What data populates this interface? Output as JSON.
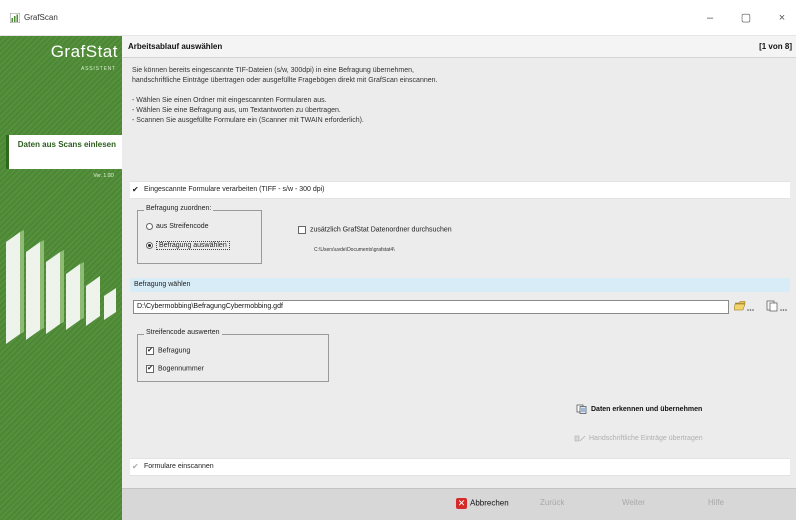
{
  "window": {
    "title": "GrafScan",
    "icon": "grafscan-app-icon",
    "controls": {
      "minimize": "–",
      "maximize": "▢",
      "close": "×"
    }
  },
  "sidebar": {
    "brand": "GrafStat",
    "subtitle": "ASSISTENT",
    "active_item": "Daten aus Scans einlesen",
    "version": "Ver. 1.0D",
    "accent": "#4f8c36"
  },
  "header": {
    "title": "Arbeitsablauf auswählen",
    "page": "[1 von 8]"
  },
  "description": {
    "line1": "Sie können bereits eingescannte TIF-Dateien (s/w, 300dpi) in eine Befragung übernehmen,",
    "line2": "handschriftliche Einträge übertragen oder ausgefüllte Fragebögen direkt mit GrafScan einscannen.",
    "bullet1": "- Wählen Sie einen Ordner mit eingescannten Formularen aus.",
    "bullet2": "- Wählen Sie eine Befragung aus, um Textantworten zu übertragen.",
    "bullet3": "- Scannen Sie ausgefüllte Formulare ein (Scanner mit TWAIN erforderlich)."
  },
  "section1": {
    "label": "Eingescannte Formulare verarbeiten (TIFF - s/w - 300 dpi)",
    "check": "✔"
  },
  "assign_group": {
    "legend": "Befragung zuordnen:",
    "option1": "aus Streifencode",
    "option2": "Befragung auswählen",
    "selected": "Befragung auswählen"
  },
  "extra_search": {
    "label": "zusätzlich GrafStat Datenordner durchsuchen",
    "checked": false,
    "path": "C:\\Users\\uvde\\Documents\\grafstat4\\"
  },
  "select_band": {
    "label": "Befragung wählen"
  },
  "file_field": {
    "value": "D:\\Cybermobbing\\BefragungCybermobbing.gdf"
  },
  "barcode_group": {
    "legend": "Streifencode auswerten",
    "cb1": "Befragung",
    "cb2": "Bogennummer",
    "cb1_checked": true,
    "cb2_checked": true
  },
  "actions": {
    "primary": "Daten erkennen und übernehmen",
    "secondary": "Handschriftliche Einträge übertragen"
  },
  "section2": {
    "label": "Formulare einscannen",
    "check": "✔"
  },
  "footer": {
    "cancel": "Abbrechen",
    "back": "Zurück",
    "next": "Weiter",
    "help": "Hilfe"
  }
}
